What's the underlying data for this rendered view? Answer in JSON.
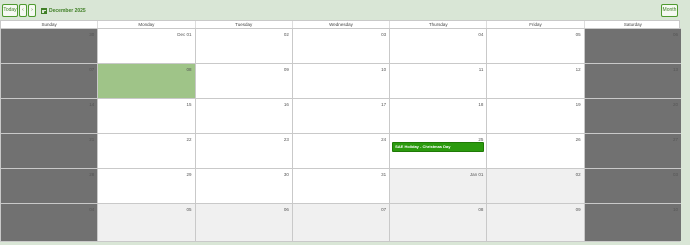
{
  "toolbar": {
    "today_label": "Today",
    "prev_label": "‹",
    "next_label": "›",
    "month_button_label": "Month",
    "date_label": "December 2025"
  },
  "weekdays": [
    "Sunday",
    "Monday",
    "Tuesday",
    "Wednesday",
    "Thursday",
    "Friday",
    "Saturday"
  ],
  "weeks": [
    [
      "30",
      "Dec 01",
      "02",
      "03",
      "04",
      "05",
      "06"
    ],
    [
      "07",
      "08",
      "09",
      "10",
      "11",
      "12",
      "13"
    ],
    [
      "14",
      "15",
      "16",
      "17",
      "18",
      "19",
      "20"
    ],
    [
      "21",
      "22",
      "23",
      "24",
      "25",
      "26",
      "27"
    ],
    [
      "28",
      "29",
      "30",
      "31",
      "Jan 01",
      "02",
      "03"
    ],
    [
      "04",
      "05",
      "06",
      "07",
      "08",
      "09",
      "10"
    ]
  ],
  "events": [
    {
      "title": "SAE Holiday - Christmas Day"
    }
  ],
  "colors": {
    "accent": "#3f7f25",
    "event": "#2b9a0e",
    "today": "#9fc488",
    "weekend": "#717171",
    "outside_month": "#f0f0f0"
  }
}
